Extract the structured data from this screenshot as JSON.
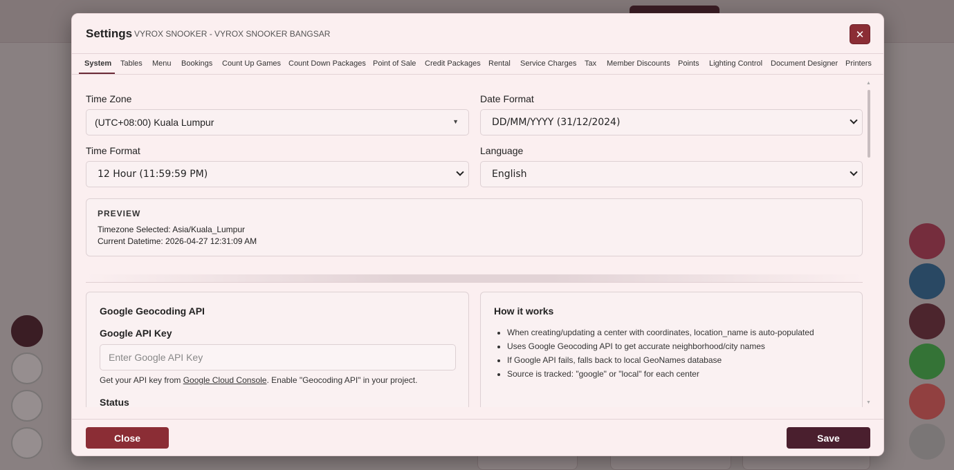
{
  "modal": {
    "title": "Settings",
    "subtitle": "VYROX SNOOKER - VYROX SNOOKER BANGSAR",
    "close_icon": "close-icon",
    "close_glyph": "✕"
  },
  "tabs": [
    {
      "label": "System",
      "active": true
    },
    {
      "label": "Tables"
    },
    {
      "label": "Menu"
    },
    {
      "label": "Bookings"
    },
    {
      "label": "Count Up Games"
    },
    {
      "label": "Count Down Packages"
    },
    {
      "label": "Point of Sale"
    },
    {
      "label": "Credit Packages"
    },
    {
      "label": "Rental"
    },
    {
      "label": "Service Charges"
    },
    {
      "label": "Tax"
    },
    {
      "label": "Member Discounts"
    },
    {
      "label": "Points"
    },
    {
      "label": "Lighting Control"
    },
    {
      "label": "Document Designer"
    },
    {
      "label": "Printers"
    }
  ],
  "system": {
    "time_zone": {
      "label": "Time Zone",
      "value": "(UTC+08:00) Kuala Lumpur"
    },
    "date_format": {
      "label": "Date Format",
      "value": "DD/MM/YYYY (31/12/2024)"
    },
    "time_format": {
      "label": "Time Format",
      "value": "12 Hour (11:59:59 PM)"
    },
    "language": {
      "label": "Language",
      "value": "English"
    },
    "preview": {
      "title": "PREVIEW",
      "timezone_line": "Timezone Selected: Asia/Kuala_Lumpur",
      "datetime_line": "Current Datetime: 2026-04-27 12:31:09 AM"
    }
  },
  "geocoding": {
    "title": "Google Geocoding API",
    "api_key_label": "Google API Key",
    "api_key_placeholder": "Enter Google API Key",
    "help_prefix": "Get your API key from ",
    "help_link": "Google Cloud Console",
    "help_suffix": ". Enable \"Geocoding API\" in your project.",
    "status_label": "Status"
  },
  "how_it_works": {
    "title": "How it works",
    "items": [
      "When creating/updating a center with coordinates, location_name is auto-populated",
      "Uses Google Geocoding API to get accurate neighborhood/city names",
      "If Google API fails, falls back to local GeoNames database",
      "Source is tracked: \"google\" or \"local\" for each center"
    ]
  },
  "footer": {
    "close_label": "Close",
    "save_label": "Save"
  },
  "colors": {
    "primary_red": "#8b2d35",
    "primary_dark": "#4a1f2e",
    "modal_bg": "#fbeff0"
  }
}
